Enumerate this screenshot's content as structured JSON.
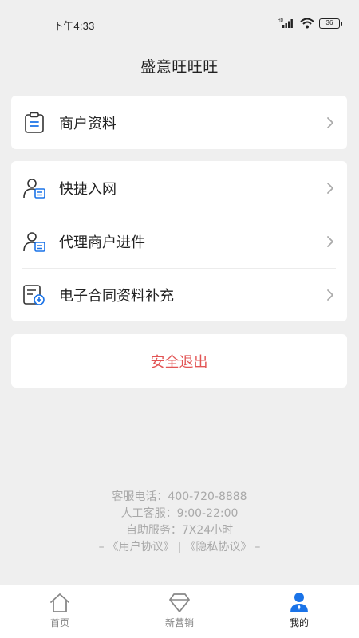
{
  "status_bar": {
    "time": "下午4:33",
    "network": "HD",
    "battery": "36"
  },
  "header": {
    "title": "盛意旺旺旺"
  },
  "menu_group_1": [
    {
      "label": "商户资料",
      "icon": "clipboard-icon"
    }
  ],
  "menu_group_2": [
    {
      "label": "快捷入网",
      "icon": "user-card-icon"
    },
    {
      "label": "代理商户进件",
      "icon": "user-card-icon"
    },
    {
      "label": "电子合同资料补充",
      "icon": "document-add-icon"
    }
  ],
  "logout": {
    "label": "安全退出",
    "color": "#e25555"
  },
  "footer": {
    "hotline": "客服电话：400-720-8888",
    "manual_service": "人工客服：9:00-22:00",
    "self_service": "自助服务：7X24小时",
    "link_prefix": "–",
    "user_agreement": "《用户协议》",
    "separator": "|",
    "privacy_policy": "《隐私协议》",
    "link_suffix": "–"
  },
  "tabbar": {
    "items": [
      {
        "label": "首页",
        "icon": "home-icon",
        "active": false
      },
      {
        "label": "新营销",
        "icon": "diamond-icon",
        "active": false
      },
      {
        "label": "我的",
        "icon": "profile-icon",
        "active": true
      }
    ],
    "active_color": "#1a73e8"
  }
}
